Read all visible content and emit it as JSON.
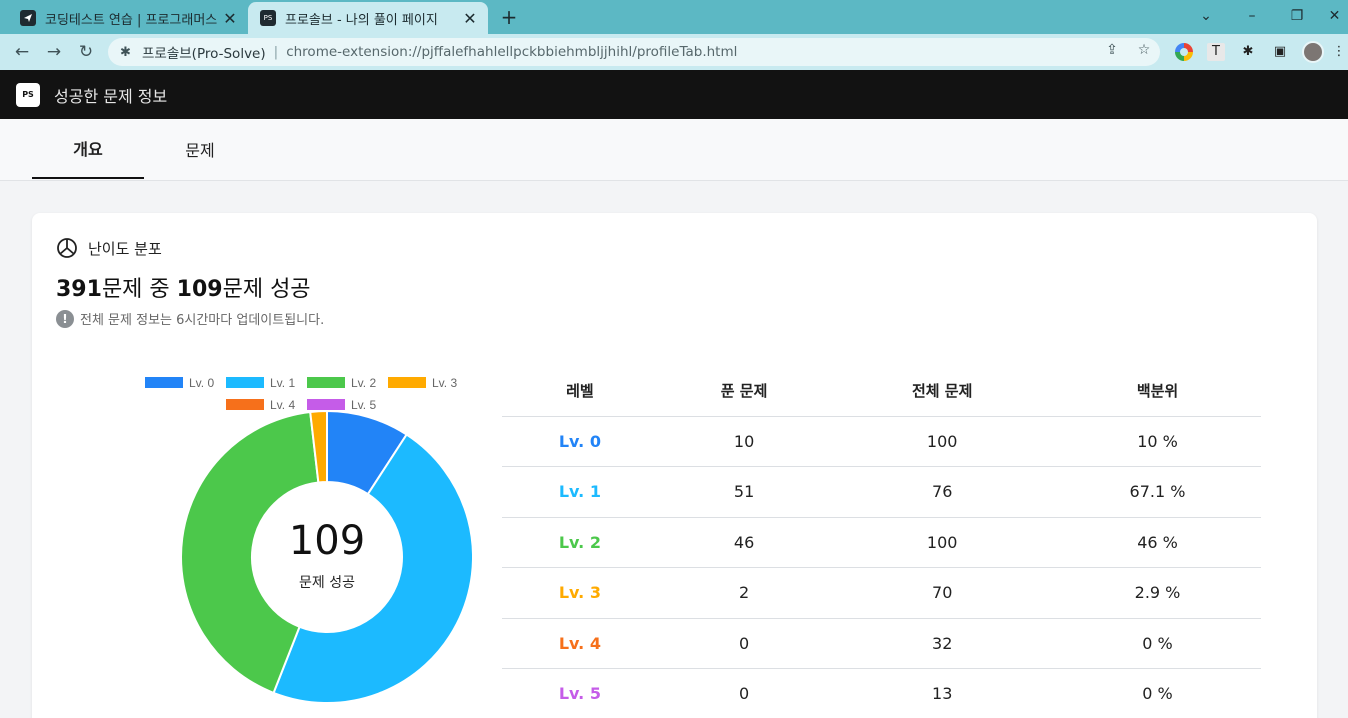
{
  "browser": {
    "tabs": [
      {
        "favicon": "programmers-logo-icon",
        "title": "코딩테스트 연습 | 프로그래머스 "
      },
      {
        "favicon": "ps-logo-icon",
        "favicon_text": "PS",
        "title": "프로솔브 - 나의 풀이 페이지"
      }
    ],
    "omnibox": {
      "extension_name": "프로솔브(Pro-Solve)",
      "url": "chrome-extension://pjffalefhahlellpckbbiehmbljjhihl/profileTab.html"
    }
  },
  "app": {
    "logo_text": "PS",
    "title": "성공한 문제 정보",
    "tabs": [
      {
        "label": "개요",
        "active": true
      },
      {
        "label": "문제",
        "active": false
      }
    ]
  },
  "section": {
    "title": "난이도 분포",
    "summary": {
      "total": "391",
      "total_suffix": "문제 중 ",
      "solved": "109",
      "solved_suffix": "문제 성공"
    },
    "notice": "전체 문제 정보는 6시간마다 업데이트됩니다."
  },
  "chart_data": {
    "type": "pie",
    "donut": true,
    "legend_position": "top",
    "center_value": "109",
    "center_label": "문제 성공",
    "categories": [
      "Lv. 0",
      "Lv. 1",
      "Lv. 2",
      "Lv. 3",
      "Lv. 4",
      "Lv. 5"
    ],
    "values": [
      10,
      51,
      46,
      2,
      0,
      0
    ],
    "colors": [
      "#2284f7",
      "#1cbaff",
      "#4cc84b",
      "#ffaa00",
      "#f6701b",
      "#c55ce8"
    ]
  },
  "table": {
    "headers": [
      "레벨",
      "푼 문제",
      "전체 문제",
      "백분위"
    ],
    "rows": [
      {
        "level": "Lv. 0",
        "solved": "10",
        "total": "100",
        "percent": "10 %",
        "color": "#2284f7"
      },
      {
        "level": "Lv. 1",
        "solved": "51",
        "total": "76",
        "percent": "67.1 %",
        "color": "#1cbaff"
      },
      {
        "level": "Lv. 2",
        "solved": "46",
        "total": "100",
        "percent": "46 %",
        "color": "#4cc84b"
      },
      {
        "level": "Lv. 3",
        "solved": "2",
        "total": "70",
        "percent": "2.9 %",
        "color": "#ffaa00"
      },
      {
        "level": "Lv. 4",
        "solved": "0",
        "total": "32",
        "percent": "0 %",
        "color": "#f6701b"
      },
      {
        "level": "Lv. 5",
        "solved": "0",
        "total": "13",
        "percent": "0 %",
        "color": "#c55ce8"
      }
    ]
  }
}
